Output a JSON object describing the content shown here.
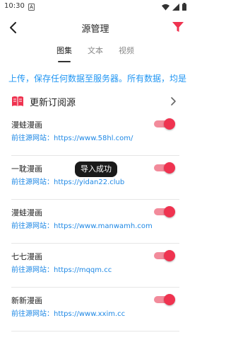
{
  "status_bar": {
    "time": "10:30",
    "icons": [
      "notification-a-icon",
      "wifi-icon",
      "signal-icon",
      "battery-icon"
    ]
  },
  "app_bar": {
    "title": "源管理",
    "back_icon": "back-arrow-icon",
    "filter_icon": "filter-icon",
    "accent_color": "#EF3350"
  },
  "tabs": [
    {
      "label": "图集",
      "active": true
    },
    {
      "label": "文本",
      "active": false
    },
    {
      "label": "视频",
      "active": false
    }
  ],
  "marquee_text": "上传，保存任何数据至服务器。所有数据，均是",
  "section": {
    "label": "更新订阅源",
    "icon": "book-icon",
    "chevron": "chevron-right-icon"
  },
  "sources": [
    {
      "name": "漫蛙漫画",
      "url": "前往源网站：https://www.58hl.com/",
      "enabled": true
    },
    {
      "name": "一耽漫画",
      "url": "前往源网站：https://yidan22.club",
      "enabled": true
    },
    {
      "name": "漫蛙漫画",
      "url": "前往源网站：https://www.manwamh.com",
      "enabled": true
    },
    {
      "name": "七七漫画",
      "url": "前往源网站：https://mqqm.cc",
      "enabled": true
    },
    {
      "name": "新新漫画",
      "url": "前往源网站：https://www.xxim.cc",
      "enabled": true
    }
  ],
  "toast": "导入成功"
}
